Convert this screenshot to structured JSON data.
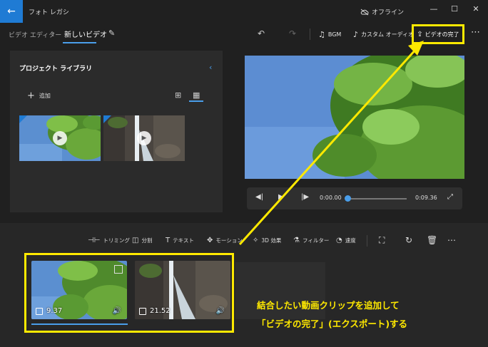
{
  "titlebar": {
    "app_title": "フォト レガシ",
    "offline_label": "オフライン",
    "back_icon": "←",
    "minimize": "—",
    "maximize": "☐",
    "close": "✕"
  },
  "toolbar": {
    "breadcrumb_parent": "ビデオ エディター",
    "breadcrumb_current": "新しいビデオ",
    "bgm_label": "BGM",
    "custom_audio_label": "カスタム オーディオ",
    "finish_video_label": "ビデオの完了",
    "more": "⋯"
  },
  "library": {
    "title": "プロジェクト ライブラリ",
    "add_label": "追加"
  },
  "player": {
    "current_time": "0:00.00",
    "total_time": "0:09.36",
    "progress": 0
  },
  "storyboard": {
    "tools": [
      {
        "label": "トリミング",
        "icon": "trim-icon"
      },
      {
        "label": "分割",
        "icon": "split-icon"
      },
      {
        "label": "テキスト",
        "icon": "text-icon"
      },
      {
        "label": "モーション",
        "icon": "motion-icon"
      },
      {
        "label": "3D 効果",
        "icon": "3d-effects-icon"
      },
      {
        "label": "フィルター",
        "icon": "filter-icon"
      },
      {
        "label": "速度",
        "icon": "speed-icon"
      }
    ],
    "clips": [
      {
        "duration": "9.37"
      },
      {
        "duration": "21.52"
      }
    ]
  },
  "annotation": {
    "line1": "結合したい動画クリップを追加して",
    "line2": "「ビデオの完了」(エクスポート)する",
    "color": "#ffe900"
  },
  "colors": {
    "accent": "#4a9eea",
    "back_button": "#1f7bd4",
    "highlight": "#ffe900"
  }
}
